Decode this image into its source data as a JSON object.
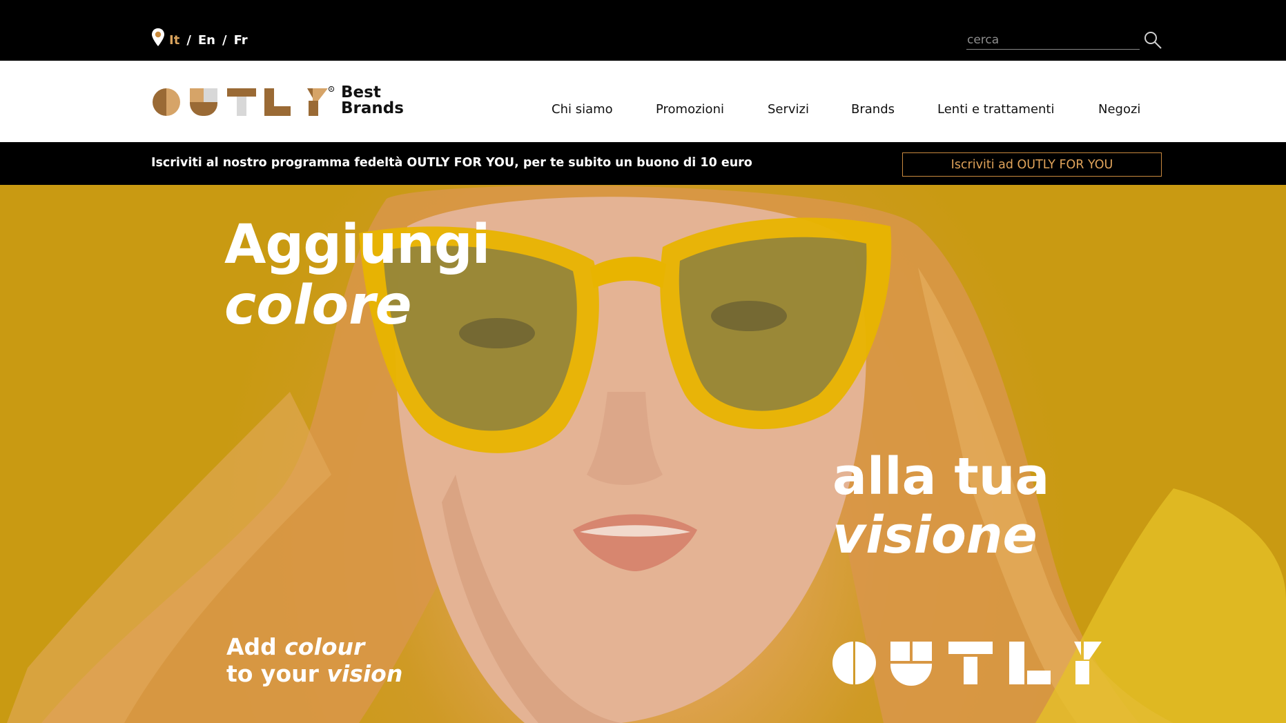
{
  "top_bar": {
    "languages": [
      {
        "label": "It",
        "active": true
      },
      {
        "label": "En",
        "active": false
      },
      {
        "label": "Fr",
        "active": false
      }
    ],
    "separator": "/",
    "search": {
      "placeholder": "cerca",
      "value": ""
    },
    "icons": [
      "location-pin-icon",
      "search-icon"
    ]
  },
  "header": {
    "logo_tagline_line1": "Best",
    "logo_tagline_line2": "Brands",
    "nav": [
      "Chi siamo",
      "Promozioni",
      "Servizi",
      "Brands",
      "Lenti e trattamenti",
      "Negozi"
    ]
  },
  "promo": {
    "text": "Iscriviti al nostro programma fedeltà OUTLY FOR YOU, per te subito un buono di 10 euro",
    "button": "Iscriviti ad OUTLY FOR YOU"
  },
  "hero": {
    "headline_line1": "Aggiungi",
    "headline_line2": "colore",
    "headline_line3": "alla tua",
    "headline_line4": "visione",
    "sub_line1_plain": "Add ",
    "sub_line1_italic": "colour",
    "sub_line2_plain": "to your ",
    "sub_line2_italic": "vision"
  },
  "colors": {
    "accent": "#d9a35d",
    "promo_button": "#e0a35a",
    "hero_background": "#cf9a25",
    "logo_dark": "#9a6a35",
    "logo_light": "#d6a468",
    "logo_grey": "#d8d8d8"
  }
}
